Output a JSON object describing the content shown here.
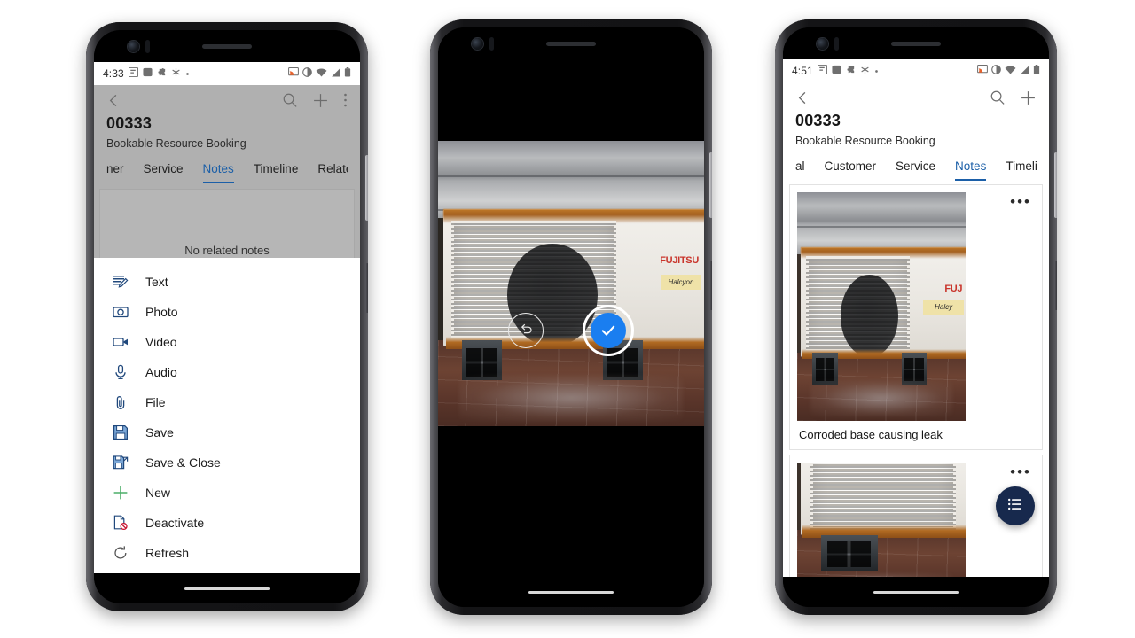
{
  "app": {
    "record_id": "00333",
    "entity_label": "Bookable Resource Booking"
  },
  "phone_left": {
    "status_bar": {
      "time": "4:33",
      "notif_icons": [
        "calendar-icon",
        "square-icon",
        "puzzle-icon",
        "sparkle-icon",
        "dot-icon"
      ],
      "system_icons": [
        "cast-icon",
        "dnd-icon",
        "wifi-icon",
        "signal-icon",
        "battery-icon"
      ]
    },
    "header": {
      "back": "back-icon",
      "search": "search-icon",
      "add": "plus-icon",
      "overflow": "more-vertical-icon",
      "title": "00333",
      "subtitle": "Bookable Resource Booking"
    },
    "tabs": [
      {
        "label": "ner",
        "active": false,
        "clipped": true
      },
      {
        "label": "Service",
        "active": false
      },
      {
        "label": "Notes",
        "active": true
      },
      {
        "label": "Timeline",
        "active": false
      },
      {
        "label": "Related",
        "active": false
      }
    ],
    "empty_state": "No related notes",
    "action_sheet": [
      {
        "label": "Text",
        "icon": "text-note-icon"
      },
      {
        "label": "Photo",
        "icon": "camera-icon"
      },
      {
        "label": "Video",
        "icon": "video-icon"
      },
      {
        "label": "Audio",
        "icon": "microphone-icon"
      },
      {
        "label": "File",
        "icon": "paperclip-icon"
      },
      {
        "label": "Save",
        "icon": "save-icon"
      },
      {
        "label": "Save & Close",
        "icon": "save-close-icon"
      },
      {
        "label": "New",
        "icon": "plus-icon"
      },
      {
        "label": "Deactivate",
        "icon": "deactivate-icon"
      },
      {
        "label": "Refresh",
        "icon": "refresh-icon"
      }
    ]
  },
  "phone_middle": {
    "mode": "camera-preview",
    "photo_subject": "Rusted Fujitsu Halcyon outdoor AC condenser on tile",
    "controls": {
      "retake": "undo-icon",
      "accept": "checkmark-icon"
    },
    "accent_color": "#1a7ef0"
  },
  "phone_right": {
    "status_bar": {
      "time": "4:51",
      "notif_icons": [
        "calendar-icon",
        "square-icon",
        "puzzle-icon",
        "sparkle-icon",
        "dot-icon"
      ],
      "system_icons": [
        "cast-icon",
        "dnd-icon",
        "wifi-icon",
        "signal-icon",
        "battery-icon"
      ]
    },
    "header": {
      "back": "back-icon",
      "search": "search-icon",
      "add": "plus-icon",
      "title": "00333",
      "subtitle": "Bookable Resource Booking"
    },
    "tabs": [
      {
        "label": "al",
        "active": false,
        "clipped": true
      },
      {
        "label": "Customer",
        "active": false
      },
      {
        "label": "Service",
        "active": false
      },
      {
        "label": "Notes",
        "active": true
      },
      {
        "label": "Timeline",
        "active": false
      }
    ],
    "notes": [
      {
        "caption": "Corroded base causing leak",
        "overflow": "more-horizontal-icon",
        "thumb": "ac-unit-full"
      },
      {
        "caption": "",
        "overflow": "more-horizontal-icon",
        "thumb": "ac-unit-closeup"
      }
    ],
    "fab": {
      "icon": "list-icon",
      "color": "#17294d"
    }
  },
  "theme": {
    "tab_active": "#1b5fa8",
    "menu_icon": "#20487c",
    "new_icon_green": "#4cae68",
    "deactivate_badge_red": "#c8102e",
    "scrim": "#b0b0b0"
  }
}
